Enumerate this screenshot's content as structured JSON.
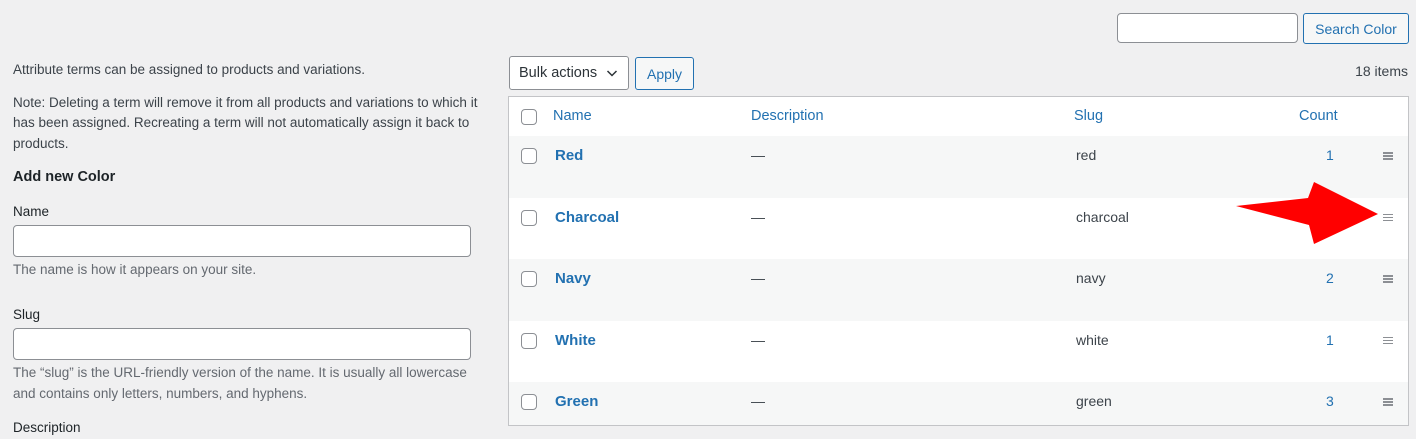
{
  "search": {
    "value": "",
    "placeholder": "",
    "button_label": "Search Color"
  },
  "sidebar": {
    "intro": "Attribute terms can be assigned to products and variations.",
    "note": "Note: Deleting a term will remove it from all products and variations to which it has been assigned. Recreating a term will not automatically assign it back to products.",
    "form_title": "Add new Color",
    "name_label": "Name",
    "name_value": "",
    "name_hint": "The name is how it appears on your site.",
    "slug_label": "Slug",
    "slug_value": "",
    "slug_hint": "The “slug” is the URL-friendly version of the name. It is usually all lowercase and contains only letters, numbers, and hyphens.",
    "description_label": "Description"
  },
  "toolbar": {
    "bulk_actions_label": "Bulk actions",
    "apply_label": "Apply",
    "items_count": "18 items"
  },
  "table": {
    "columns": [
      "Name",
      "Description",
      "Slug",
      "Count"
    ],
    "rows": [
      {
        "name": "Red",
        "description": "—",
        "slug": "red",
        "count": "1"
      },
      {
        "name": "Charcoal",
        "description": "—",
        "slug": "charcoal",
        "count": ""
      },
      {
        "name": "Navy",
        "description": "—",
        "slug": "navy",
        "count": "2"
      },
      {
        "name": "White",
        "description": "—",
        "slug": "white",
        "count": "1"
      },
      {
        "name": "Green",
        "description": "—",
        "slug": "green",
        "count": "3"
      }
    ]
  },
  "icons": {
    "drag_handle": "drag-handle-icon",
    "dropdown": "chevron-down-icon",
    "annotation": "red-arrow-annotation"
  },
  "colors": {
    "accent": "#2271b1",
    "background": "#f0f0f1",
    "annotation_arrow": "#ff0000"
  }
}
